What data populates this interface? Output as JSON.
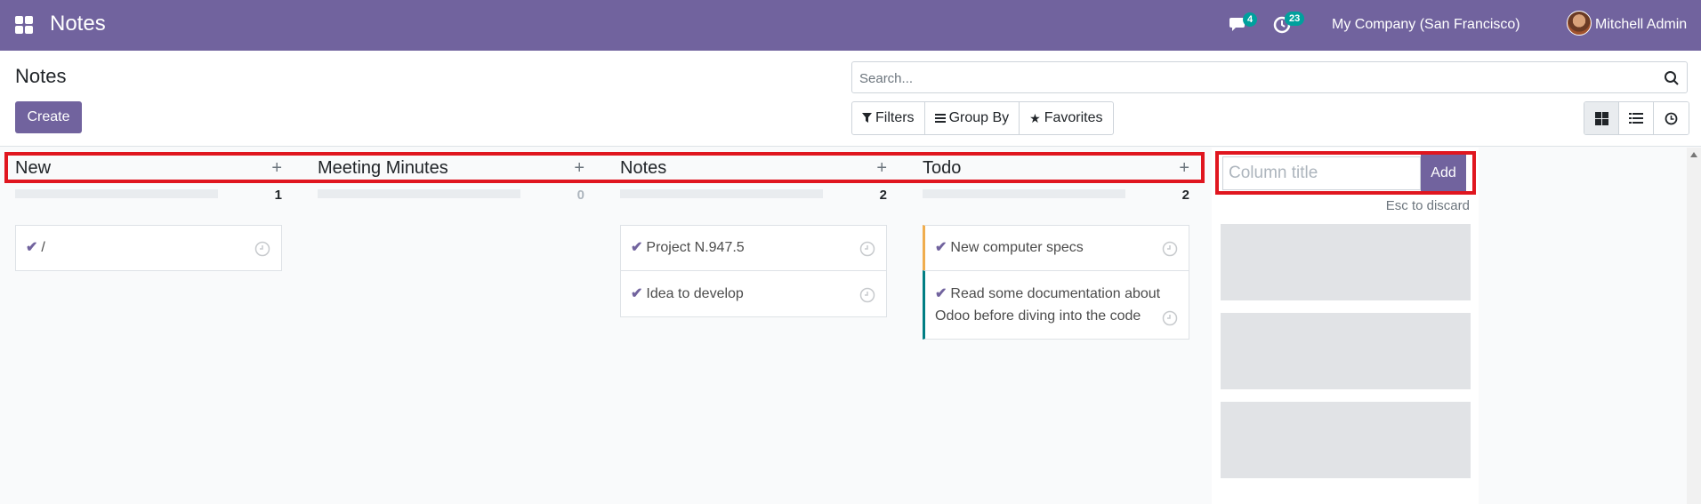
{
  "navbar": {
    "app_title": "Notes",
    "chat_badge": "4",
    "activity_badge": "23",
    "company": "My Company (San Francisco)",
    "user": "Mitchell Admin",
    "color": "#71639e"
  },
  "control_panel": {
    "title": "Notes",
    "create_label": "Create",
    "search_placeholder": "Search...",
    "filters": [
      {
        "label": "Filters",
        "icon": "filter-icon"
      },
      {
        "label": "Group By",
        "icon": "list-icon"
      },
      {
        "label": "Favorites",
        "icon": "star-icon"
      }
    ],
    "views": [
      "kanban-view-icon",
      "list-view-icon",
      "activity-view-icon"
    ]
  },
  "kanban": {
    "columns": [
      {
        "title": "New",
        "count": "1",
        "cards": [
          {
            "text": "/"
          }
        ]
      },
      {
        "title": "Meeting Minutes",
        "count": "0",
        "cards": []
      },
      {
        "title": "Notes",
        "count": "2",
        "cards": [
          {
            "text": "Project N.947.5"
          },
          {
            "text": "Idea to develop"
          }
        ]
      },
      {
        "title": "Todo",
        "count": "2",
        "cards": [
          {
            "text": "New computer specs"
          },
          {
            "text": "Read some documentation about Odoo before diving into the code"
          }
        ]
      }
    ],
    "new_column": {
      "placeholder": "Column title",
      "add_label": "Add",
      "hint": "Esc to discard"
    }
  },
  "colors": {
    "highlight": "#e0161f",
    "primary": "#71639e",
    "todo_orange": "#f0ad4e",
    "todo_teal": "#017e84"
  }
}
